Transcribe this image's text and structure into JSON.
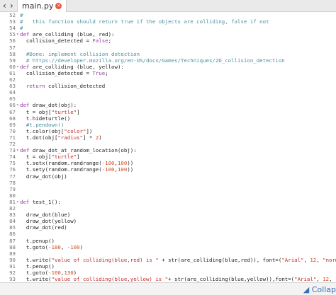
{
  "tab": {
    "label": "main.py",
    "close_icon": "close-icon",
    "close_glyph": "×"
  },
  "nav": {
    "back_glyph": "‹",
    "fwd_glyph": "›"
  },
  "bottom": {
    "label": "◢ Collap"
  },
  "editor_lines": [
    {
      "n": "52",
      "fold": false,
      "segs": [
        {
          "t": "#",
          "c": "c"
        }
      ]
    },
    {
      "n": "53",
      "fold": false,
      "segs": [
        {
          "t": "#   this function should return true if the objects are colliding, false if not",
          "c": "c"
        }
      ]
    },
    {
      "n": "54",
      "fold": false,
      "segs": [
        {
          "t": "#",
          "c": "c"
        }
      ]
    },
    {
      "n": "55",
      "fold": true,
      "segs": [
        {
          "t": "def ",
          "c": "k"
        },
        {
          "t": "are_colliding (blue, red):",
          "c": ""
        }
      ]
    },
    {
      "n": "56",
      "fold": false,
      "segs": [
        {
          "t": "  collision_detected = ",
          "c": ""
        },
        {
          "t": "False",
          "c": "k"
        },
        {
          "t": ";",
          "c": ""
        }
      ]
    },
    {
      "n": "57",
      "fold": false,
      "segs": []
    },
    {
      "n": "58",
      "fold": false,
      "segs": [
        {
          "t": "  #Done: implement collision detection",
          "c": "c"
        }
      ]
    },
    {
      "n": "59",
      "fold": false,
      "segs": [
        {
          "t": "  # https://developer.mozilla.org/en-US/docs/Games/Techniques/2D_collision_detection",
          "c": "c"
        }
      ]
    },
    {
      "n": "60",
      "fold": true,
      "segs": [
        {
          "t": "def ",
          "c": "k"
        },
        {
          "t": "are_colliding (blue, yellow):",
          "c": ""
        }
      ]
    },
    {
      "n": "61",
      "fold": false,
      "segs": [
        {
          "t": "  collision_detected = ",
          "c": ""
        },
        {
          "t": "True",
          "c": "k"
        },
        {
          "t": ";",
          "c": ""
        }
      ]
    },
    {
      "n": "62",
      "fold": false,
      "segs": []
    },
    {
      "n": "63",
      "fold": false,
      "segs": [
        {
          "t": "  ",
          "c": ""
        },
        {
          "t": "return",
          "c": "k"
        },
        {
          "t": " collision_detected",
          "c": ""
        }
      ]
    },
    {
      "n": "64",
      "fold": false,
      "segs": []
    },
    {
      "n": "65",
      "fold": false,
      "segs": []
    },
    {
      "n": "66",
      "fold": true,
      "segs": [
        {
          "t": "def ",
          "c": "k"
        },
        {
          "t": "draw_dot(obj):",
          "c": ""
        }
      ]
    },
    {
      "n": "67",
      "fold": false,
      "segs": [
        {
          "t": "  t = obj[",
          "c": ""
        },
        {
          "t": "\"turtle\"",
          "c": "s"
        },
        {
          "t": "]",
          "c": ""
        }
      ]
    },
    {
      "n": "68",
      "fold": false,
      "segs": [
        {
          "t": "  t.hideturtle()",
          "c": ""
        }
      ]
    },
    {
      "n": "69",
      "fold": false,
      "segs": [
        {
          "t": "  #t.pendown()",
          "c": "c"
        }
      ]
    },
    {
      "n": "70",
      "fold": false,
      "segs": [
        {
          "t": "  t.color(obj[",
          "c": ""
        },
        {
          "t": "\"color\"",
          "c": "s"
        },
        {
          "t": "])",
          "c": ""
        }
      ]
    },
    {
      "n": "71",
      "fold": false,
      "segs": [
        {
          "t": "  t.dot(obj[",
          "c": ""
        },
        {
          "t": "\"radius\"",
          "c": "s"
        },
        {
          "t": "] * ",
          "c": ""
        },
        {
          "t": "2",
          "c": "n"
        },
        {
          "t": ")",
          "c": ""
        }
      ]
    },
    {
      "n": "72",
      "fold": false,
      "segs": []
    },
    {
      "n": "73",
      "fold": true,
      "segs": [
        {
          "t": "def ",
          "c": "k"
        },
        {
          "t": "draw_dot_at_random_location(obj):",
          "c": ""
        }
      ]
    },
    {
      "n": "74",
      "fold": false,
      "segs": [
        {
          "t": "  t = obj[",
          "c": ""
        },
        {
          "t": "\"turtle\"",
          "c": "s"
        },
        {
          "t": "]",
          "c": ""
        }
      ]
    },
    {
      "n": "75",
      "fold": false,
      "segs": [
        {
          "t": "  t.setx(random.randrange(",
          "c": ""
        },
        {
          "t": "-100",
          "c": "n"
        },
        {
          "t": ",",
          "c": ""
        },
        {
          "t": "100",
          "c": "n"
        },
        {
          "t": "))",
          "c": ""
        }
      ]
    },
    {
      "n": "76",
      "fold": false,
      "segs": [
        {
          "t": "  t.sety(random.randrange(",
          "c": ""
        },
        {
          "t": "-100",
          "c": "n"
        },
        {
          "t": ",",
          "c": ""
        },
        {
          "t": "100",
          "c": "n"
        },
        {
          "t": "))",
          "c": ""
        }
      ]
    },
    {
      "n": "77",
      "fold": false,
      "segs": [
        {
          "t": "  draw_dot(obj)",
          "c": ""
        }
      ]
    },
    {
      "n": "78",
      "fold": false,
      "segs": []
    },
    {
      "n": "79",
      "fold": false,
      "segs": []
    },
    {
      "n": "80",
      "fold": false,
      "segs": []
    },
    {
      "n": "81",
      "fold": true,
      "segs": [
        {
          "t": "def ",
          "c": "k"
        },
        {
          "t": "test_1():",
          "c": ""
        }
      ]
    },
    {
      "n": "82",
      "fold": false,
      "segs": []
    },
    {
      "n": "83",
      "fold": false,
      "segs": [
        {
          "t": "  draw_dot(blue)",
          "c": ""
        }
      ]
    },
    {
      "n": "84",
      "fold": false,
      "segs": [
        {
          "t": "  draw_dot(yellow)",
          "c": ""
        }
      ]
    },
    {
      "n": "85",
      "fold": false,
      "segs": [
        {
          "t": "  draw_dot(red)",
          "c": ""
        }
      ]
    },
    {
      "n": "86",
      "fold": false,
      "segs": []
    },
    {
      "n": "87",
      "fold": false,
      "segs": [
        {
          "t": "  t.penup()",
          "c": ""
        }
      ]
    },
    {
      "n": "88",
      "fold": false,
      "segs": [
        {
          "t": "  t.goto(",
          "c": ""
        },
        {
          "t": "-180",
          "c": "n"
        },
        {
          "t": ", ",
          "c": ""
        },
        {
          "t": "-100",
          "c": "n"
        },
        {
          "t": ")",
          "c": ""
        }
      ]
    },
    {
      "n": "89",
      "fold": false,
      "segs": []
    },
    {
      "n": "90",
      "fold": false,
      "segs": [
        {
          "t": "  t.write(",
          "c": ""
        },
        {
          "t": "\"value of colliding(blue,red) is \"",
          "c": "s"
        },
        {
          "t": " + str(are_colliding(blue,red)), font=(",
          "c": ""
        },
        {
          "t": "\"Arial\"",
          "c": "s"
        },
        {
          "t": ", ",
          "c": ""
        },
        {
          "t": "12",
          "c": "n"
        },
        {
          "t": ", ",
          "c": ""
        },
        {
          "t": "\"normal\"",
          "c": "s"
        },
        {
          "t": "))",
          "c": ""
        }
      ]
    },
    {
      "n": "91",
      "fold": false,
      "segs": [
        {
          "t": "  t.penup()",
          "c": ""
        }
      ]
    },
    {
      "n": "92",
      "fold": false,
      "segs": [
        {
          "t": "  t.goto(",
          "c": ""
        },
        {
          "t": "-160",
          "c": "n"
        },
        {
          "t": ",",
          "c": ""
        },
        {
          "t": "130",
          "c": "n"
        },
        {
          "t": ")",
          "c": ""
        }
      ]
    },
    {
      "n": "93",
      "fold": false,
      "segs": [
        {
          "t": "  t.write(",
          "c": ""
        },
        {
          "t": "\"value of colliding(blue,yellow) is \"",
          "c": "s"
        },
        {
          "t": "+ str(are_colliding(blue,yellow)),font=(",
          "c": ""
        },
        {
          "t": "\"Arial\"",
          "c": "s"
        },
        {
          "t": ", ",
          "c": ""
        },
        {
          "t": "12",
          "c": "n"
        },
        {
          "t": ", ",
          "c": ""
        },
        {
          "t": "\"normal\"",
          "c": "s"
        },
        {
          "t": "))",
          "c": ""
        }
      ]
    },
    {
      "n": "94",
      "fold": false,
      "segs": [
        {
          "t": "  t.penup()",
          "c": ""
        }
      ]
    },
    {
      "n": "95",
      "fold": false,
      "segs": [
        {
          "t": "  t.goto(",
          "c": ""
        },
        {
          "t": "-180",
          "c": "n"
        },
        {
          "t": ", ",
          "c": ""
        },
        {
          "t": "-160",
          "c": "n"
        },
        {
          "t": ")",
          "c": ""
        }
      ]
    }
  ]
}
